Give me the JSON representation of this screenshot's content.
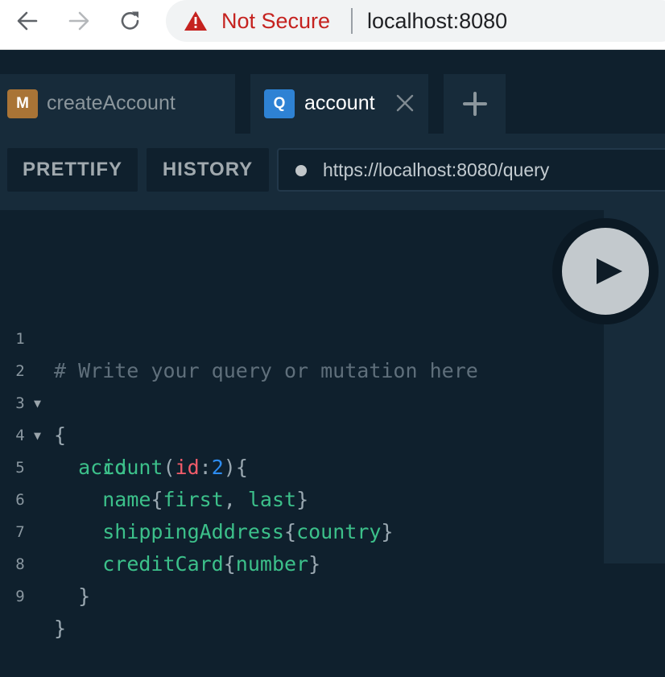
{
  "browser": {
    "security_label": "Not Secure",
    "address": "localhost:8080"
  },
  "tabs": [
    {
      "badge": "M",
      "label": "createAccount",
      "badge_color": "#a97436",
      "active": false
    },
    {
      "badge": "Q",
      "label": "account",
      "badge_color": "#2e82d4",
      "active": true
    }
  ],
  "add_tab_label": "+",
  "toolbar": {
    "prettify_label": "PRETTIFY",
    "history_label": "HISTORY",
    "endpoint_url": "https://localhost:8080/query"
  },
  "editor": {
    "lines": [
      {
        "number": "1",
        "foldable": false,
        "text": "# Write your query or mutation here"
      },
      {
        "number": "2",
        "foldable": true,
        "text": "{"
      },
      {
        "number": "3",
        "foldable": true,
        "text": "  account(id:2){"
      },
      {
        "number": "4",
        "foldable": false,
        "text": "    id"
      },
      {
        "number": "5",
        "foldable": false,
        "text": "    name{first, last}"
      },
      {
        "number": "6",
        "foldable": false,
        "text": "    shippingAddress{country}"
      },
      {
        "number": "7",
        "foldable": false,
        "text": "    creditCard{number}"
      },
      {
        "number": "8",
        "foldable": false,
        "text": "  }"
      },
      {
        "number": "9",
        "foldable": false,
        "text": "}"
      }
    ],
    "query_field": "account",
    "argument_name": "id",
    "argument_value": "2",
    "fields": [
      "id",
      "name",
      "first",
      "last",
      "shippingAddress",
      "country",
      "creditCard",
      "number"
    ]
  },
  "colors": {
    "background": "#0f202d",
    "panel": "#172b3a",
    "field": "#3cc08a",
    "argument": "#f25c6a",
    "number": "#2d8cf0",
    "comment": "#5f6f7b",
    "not_secure": "#c5221f"
  },
  "icons": {
    "back": "arrow-left-icon",
    "forward": "arrow-right-icon",
    "reload": "reload-icon",
    "warning": "warning-triangle-icon",
    "close": "close-icon",
    "play": "play-icon"
  }
}
